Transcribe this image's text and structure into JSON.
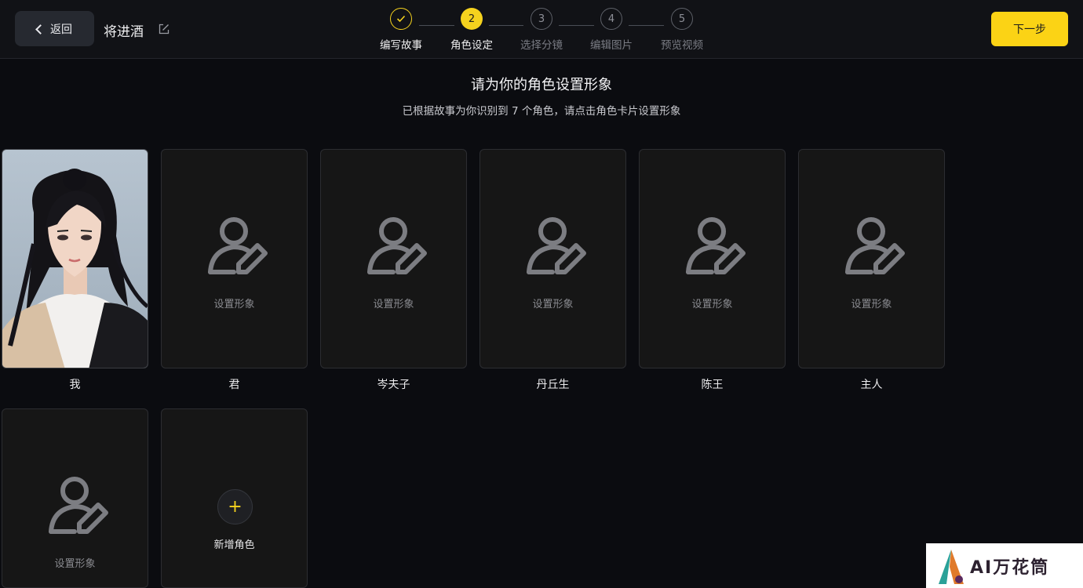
{
  "header": {
    "back_label": "返回",
    "project_title": "将进酒",
    "next_label": "下一步",
    "accent_color": "#fbd315"
  },
  "steps": [
    {
      "number": "1",
      "label": "编写故事",
      "state": "done"
    },
    {
      "number": "2",
      "label": "角色设定",
      "state": "active"
    },
    {
      "number": "3",
      "label": "选择分镜",
      "state": "todo"
    },
    {
      "number": "4",
      "label": "编辑图片",
      "state": "todo"
    },
    {
      "number": "5",
      "label": "预览视频",
      "state": "todo"
    }
  ],
  "main": {
    "heading": "请为你的角色设置形象",
    "subheading": "已根据故事为你识别到 7 个角色，请点击角色卡片设置形象",
    "placeholder_label": "设置形象",
    "characters": [
      {
        "name": "我",
        "has_image": true
      },
      {
        "name": "君",
        "has_image": false
      },
      {
        "name": "岑夫子",
        "has_image": false
      },
      {
        "name": "丹丘生",
        "has_image": false
      },
      {
        "name": "陈王",
        "has_image": false
      },
      {
        "name": "主人",
        "has_image": false
      },
      {
        "name": "",
        "has_image": false
      }
    ],
    "add_label": "新增角色"
  },
  "watermark": {
    "text": "AI万花筒"
  }
}
